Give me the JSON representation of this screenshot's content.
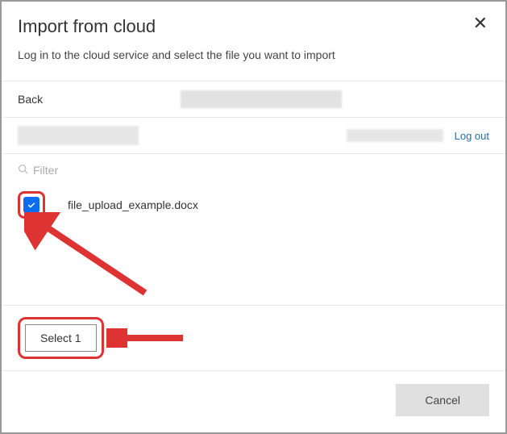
{
  "modal": {
    "title": "Import from cloud",
    "subtitle": "Log in to the cloud service and select the file you want to import",
    "close_label": "✕"
  },
  "nav": {
    "back_label": "Back"
  },
  "account": {
    "logout_label": "Log out"
  },
  "filter": {
    "placeholder": "Filter"
  },
  "file": {
    "name": "file_upload_example.docx",
    "checked": true
  },
  "actions": {
    "select_label": "Select 1",
    "cancel_label": "Cancel"
  }
}
